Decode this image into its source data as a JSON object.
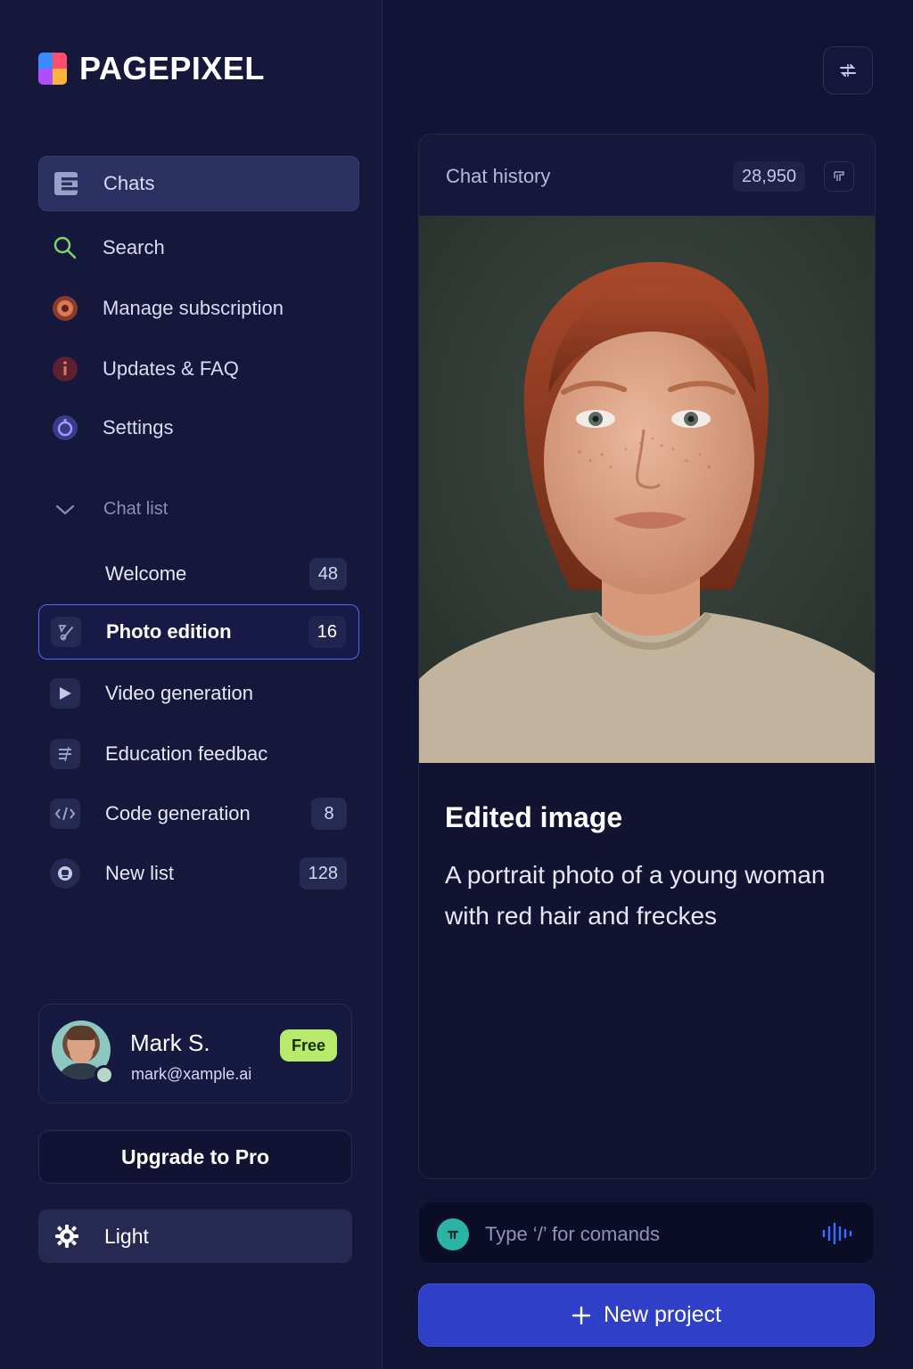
{
  "brand": {
    "name": "PAGEPIXEL"
  },
  "nav": {
    "items": [
      {
        "label": "Chats",
        "icon": "chats-icon",
        "active": true
      },
      {
        "label": "Search",
        "icon": "search-icon"
      },
      {
        "label": "Manage subscription",
        "icon": "subscription-icon"
      },
      {
        "label": "Updates & FAQ",
        "icon": "info-icon"
      },
      {
        "label": "Settings",
        "icon": "settings-icon"
      }
    ]
  },
  "chat_list": {
    "title": "Chat list",
    "items": [
      {
        "label": "Welcome",
        "count": "48",
        "icon": ""
      },
      {
        "label": "Photo edition",
        "count": "16",
        "icon": "photo-edit-icon",
        "selected": true
      },
      {
        "label": "Video generation",
        "count": "",
        "icon": "play-icon"
      },
      {
        "label": "Education feedbac",
        "count": "",
        "icon": "list-icon"
      },
      {
        "label": "Code generation",
        "count": "8",
        "icon": "code-icon"
      },
      {
        "label": "New list",
        "count": "128",
        "icon": "robot-icon"
      }
    ]
  },
  "profile": {
    "name": "Mark S.",
    "email": "mark@xample.ai",
    "plan": "Free",
    "plan_color": "#b8ea6c"
  },
  "upgrade": {
    "label": "Upgrade to Pro"
  },
  "theme": {
    "label": "Light",
    "icon": "gear-icon"
  },
  "history": {
    "title": "Chat history",
    "count": "28,950"
  },
  "result": {
    "title": "Edited image",
    "description": "A portrait photo of a young woman with red hair and freckes"
  },
  "composer": {
    "placeholder": "Type ‘/’ for comands"
  },
  "actions": {
    "new_project": "New project"
  },
  "colors": {
    "accent": "#2f3fc8",
    "selected_border": "#5b63ff",
    "background": "#14163a"
  }
}
